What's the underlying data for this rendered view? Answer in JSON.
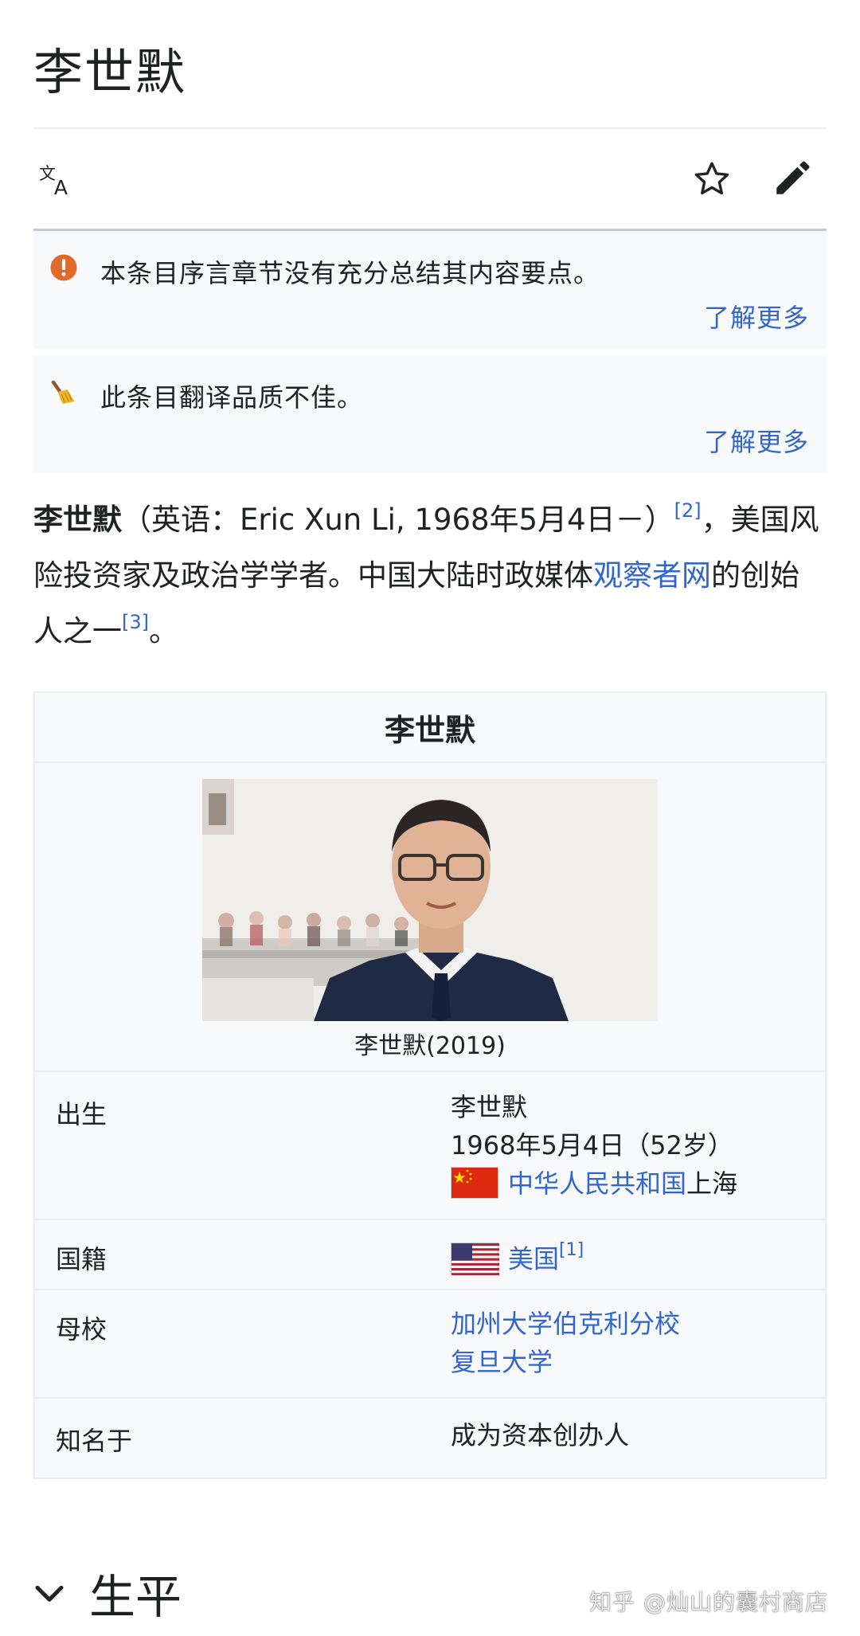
{
  "page": {
    "title": "李世默"
  },
  "notices": [
    {
      "text": "本条目序言章节没有充分总结其内容要点。",
      "more": "了解更多",
      "icon": "warning-icon"
    },
    {
      "text": "此条目翻译品质不佳。",
      "more": "了解更多",
      "icon": "broom-icon"
    }
  ],
  "lead": {
    "name": "李世默",
    "part1": "（英语：Eric Xun Li, 1968年5月4日－）",
    "ref1": "[2]",
    "part2": "，美国风险投资家及政治学学者。中国大陆时政媒体",
    "link": "观察者网",
    "part3": "的创始人之一",
    "ref2": "[3]",
    "part4": "。"
  },
  "infobox": {
    "title": "李世默",
    "caption": "李世默(2019)",
    "rows": [
      {
        "label": "出生",
        "line1": "李世默",
        "line2": "1968年5月4日（52岁）",
        "place_link": "中华人民共和国",
        "place_text": "上海"
      },
      {
        "label": "国籍",
        "value_link": "美国",
        "ref": "[1]"
      },
      {
        "label": "母校",
        "value1": "加州大学伯克利分校",
        "value2": "复旦大学"
      },
      {
        "label": "知名于",
        "value": "成为资本创办人"
      }
    ]
  },
  "section": {
    "title": "生平"
  },
  "watermark": "知乎 @灿山的囊村商店",
  "colors": {
    "link": "#3366cc",
    "warning": "#fc3",
    "notice_bg": "#f8f9fa"
  }
}
